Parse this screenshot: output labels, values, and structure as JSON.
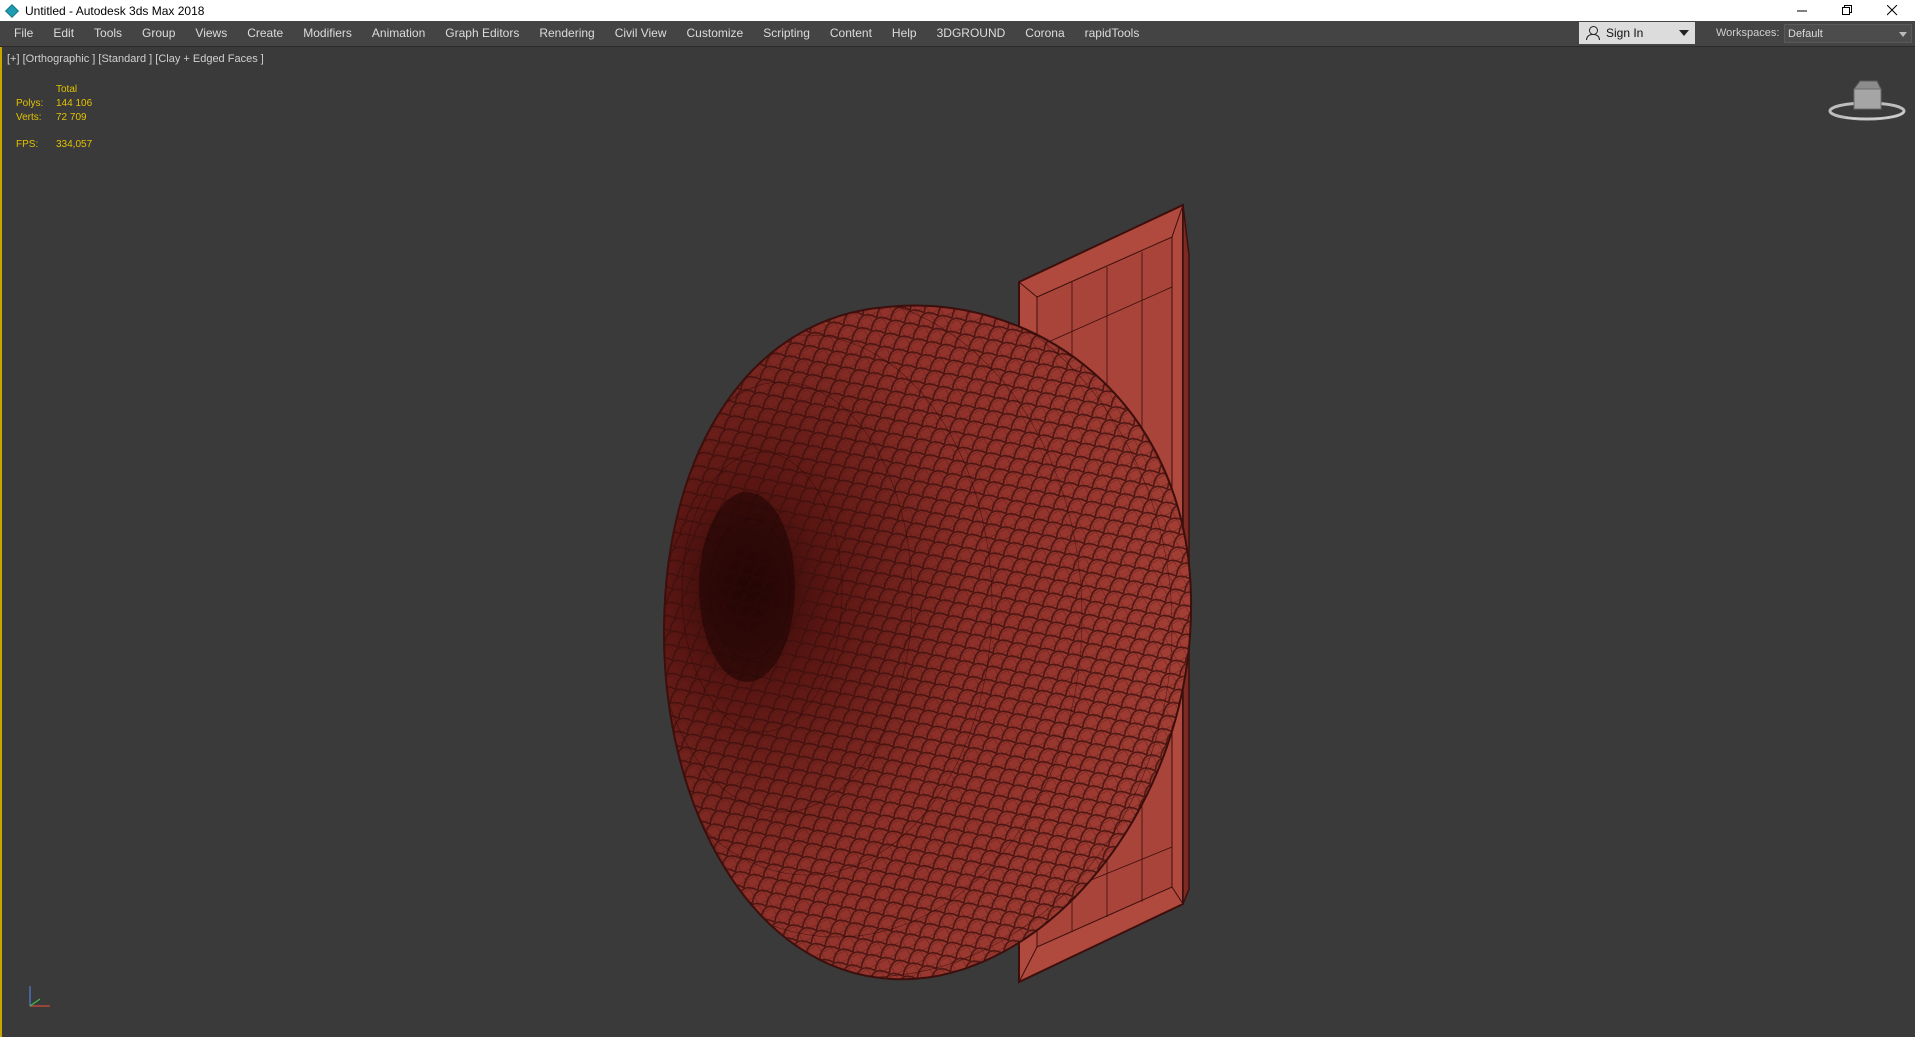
{
  "window": {
    "title": "Untitled - Autodesk 3ds Max 2018",
    "controls": [
      "minimize",
      "restore",
      "close"
    ]
  },
  "menu": [
    "File",
    "Edit",
    "Tools",
    "Group",
    "Views",
    "Create",
    "Modifiers",
    "Animation",
    "Graph Editors",
    "Rendering",
    "Civil View",
    "Customize",
    "Scripting",
    "Content",
    "Help",
    "3DGROUND",
    "Corona",
    "rapidTools"
  ],
  "account": {
    "sign_in_label": "Sign In"
  },
  "workspaces": {
    "label": "Workspaces:",
    "value": "Default"
  },
  "viewport": {
    "label": "[+] [Orthographic ] [Standard ] [Clay + Edged Faces ]",
    "stats": {
      "total_label": "Total",
      "polys_label": "Polys:",
      "polys_value": "144 106",
      "verts_label": "Verts:",
      "verts_value": "72 709",
      "fps_label": "FPS:",
      "fps_value": "334,057"
    }
  },
  "colors": {
    "viewport_bg": "#3a3a3a",
    "stats_text": "#e2c200",
    "active_border": "#c8a800",
    "model_fill": "#a33f37",
    "wire": "#3d0f0c"
  },
  "icons": {
    "app": "3dsmax-icon",
    "user": "user-icon",
    "viewcube": "viewcube-icon",
    "axis": "axis-tripod-icon"
  }
}
